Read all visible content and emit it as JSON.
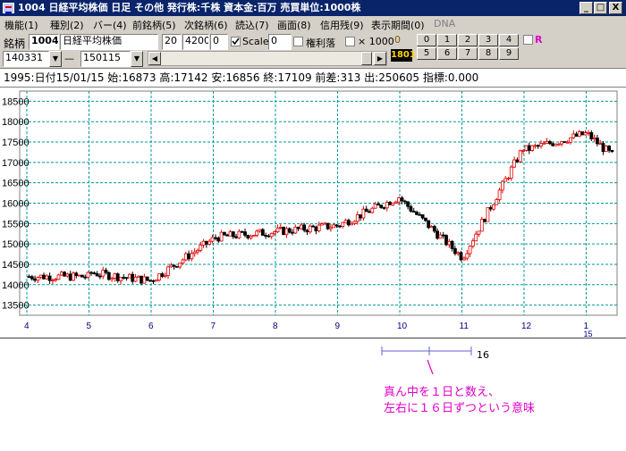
{
  "window": {
    "title": "1004 日経平均株価  日足  その他  発行株:千株  資本金:百万  売買単位:1000株",
    "minimize": "_",
    "maximize": "□",
    "close": "X"
  },
  "menu": [
    "機能(1)",
    "種別(2)",
    "バー(4)",
    "前銘柄(5)",
    "次銘柄(6)",
    "読込(7)",
    "画面(8)",
    "信用残(9)",
    "表示期間(0)",
    "DNA"
  ],
  "toolbar": {
    "code_label": "銘柄",
    "code": "1004",
    "name": "日経平均株価",
    "param1": "20",
    "param2": "4200",
    "param3": "0",
    "scale_label": "Scale",
    "scale_value": "0",
    "dividend_label": "権利落",
    "x1000_label": "× 1000",
    "zero_label": "0",
    "num_1801": "1801",
    "numpad_row1": [
      "0",
      "1",
      "2",
      "3",
      "4"
    ],
    "numpad_row2": [
      "5",
      "6",
      "7",
      "8",
      "9"
    ],
    "r_label": "R",
    "date_from": "140331",
    "dash": "—",
    "date_to": "150115"
  },
  "info": "1995:日付15/01/15  始:16873  高:17142  安:16856  終:17109  前差:313  出:250605  指標:0.000",
  "colors": {
    "up": "#e00000",
    "down": "#000000",
    "grid": "#009999",
    "annotation": "#e000c8",
    "titlebar": "#0a246a"
  },
  "chart_data": {
    "type": "candlestick",
    "yticks": [
      13500,
      14000,
      14500,
      15000,
      15500,
      16000,
      16500,
      17000,
      17500,
      18000,
      18500
    ],
    "ylim": [
      13250,
      18750
    ],
    "month_labels": [
      "4",
      "5",
      "6",
      "7",
      "8",
      "9",
      "10",
      "11",
      "12",
      "1"
    ],
    "year_label": "15",
    "x": [
      "2014-04",
      "2014-05",
      "2014-06",
      "2014-07",
      "2014-08",
      "2014-09",
      "2014-10",
      "2014-11",
      "2014-12",
      "2015-01"
    ],
    "trend_close": [
      14200,
      14100,
      15100,
      15300,
      15450,
      16150,
      14700,
      17350,
      17700,
      17109
    ],
    "grid": true
  },
  "subchart": {
    "label": "16",
    "annotation_line1": "真ん中を１日と数え、",
    "annotation_line2": "左右に１６日ずつという意味"
  }
}
